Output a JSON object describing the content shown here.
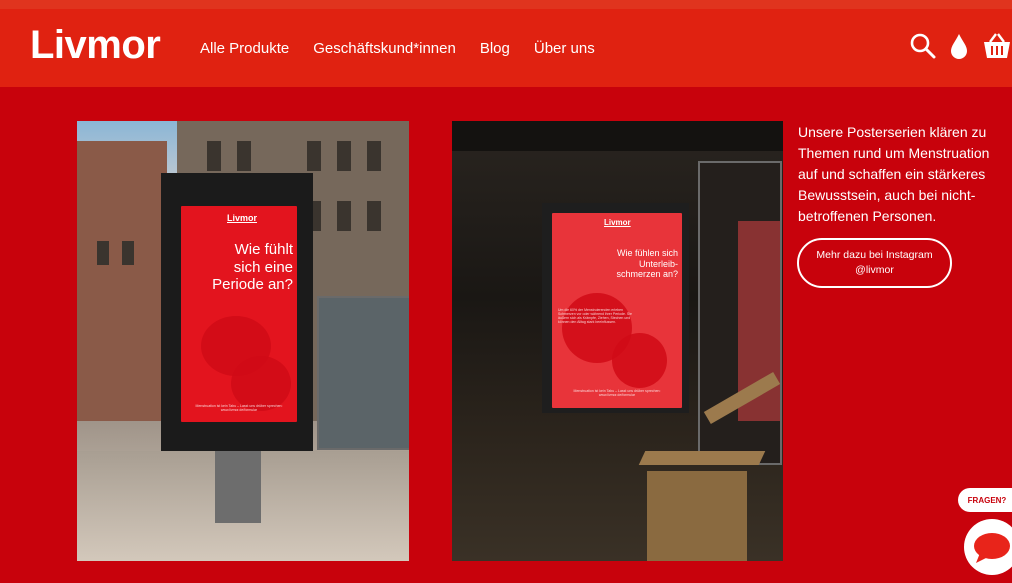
{
  "brand": {
    "logo": "Livmor"
  },
  "nav": {
    "items": [
      "Alle Produkte",
      "Geschäftskund*innen",
      "Blog",
      "Über uns"
    ]
  },
  "header_icons": [
    "search-icon",
    "drop-icon",
    "cart-icon"
  ],
  "posters": [
    {
      "logo": "Livmor",
      "headline_lines": [
        "Wie fühlt",
        "sich eine",
        "Periode an?"
      ],
      "footer": [
        "Menstruation ist kein Tabu – Lasst uns drüber sprechen:",
        "www.livmor.de/formular"
      ]
    },
    {
      "logo": "Livmor",
      "headline_lines": [
        "Wie fühlen sich",
        "Unterleib-",
        "schmerzen an?"
      ],
      "body": "Um die 60% der Menstruierenden erleben Schmerzen vor oder während ihrer Periode. Sie äußern sich als Krämpfe, Ziehen, Stechen und können den Alltag stark beeinflussen.",
      "footer": [
        "Menstruation ist kein Tabu – Lasst uns drüber sprechen:",
        "www.livmor.de/formular"
      ]
    }
  ],
  "description": "Unsere Posterserien klären zu Themen rund um Menstruation auf und schaffen ein stärkeres Bewusstsein, auch bei nicht-betroffenen Personen.",
  "cta": {
    "line1": "Mehr dazu bei Instagram",
    "line2": "@livmor"
  },
  "help": {
    "label": "FRAGEN?"
  },
  "colors": {
    "background": "#c8020c",
    "header": "#e02211",
    "poster_red": "#e3141e"
  }
}
